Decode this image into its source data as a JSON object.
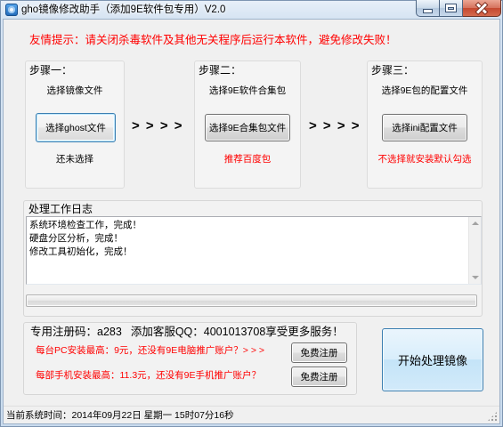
{
  "window": {
    "title": "gho镜像修改助手（添加9E软件包专用）V2.0"
  },
  "icons": {
    "app": "app-icon",
    "minimize": "minimize-icon",
    "maximize": "maximize-icon",
    "close": "close-icon",
    "scroll_up": "chevron-up-icon",
    "scroll_down": "chevron-down-icon",
    "resize_grip": "resize-grip-icon"
  },
  "colors": {
    "warning": "#ff0000",
    "normal_text": "#000000",
    "focus_border": "#3c7fb1",
    "close_button": "#c4472f"
  },
  "notice": "友情提示：请关闭杀毒软件及其他无关程序后运行本软件，避免修改失败！",
  "steps": [
    {
      "label": "步骤一：",
      "description": "选择镜像文件",
      "button": "选择ghost文件",
      "status": "还未选择",
      "status_color": "#000000"
    },
    {
      "label": "步骤二：",
      "description": "选择9E软件合集包",
      "button": "选择9E合集包文件",
      "status": "推荐百度包",
      "status_color": "#ff0000"
    },
    {
      "label": "步骤三：",
      "description": "选择9E包的配置文件",
      "button": "选择ini配置文件",
      "status": "不选择就安装默认勾选",
      "status_color": "#ff0000"
    }
  ],
  "arrows": [
    "> > > >",
    "> > > >"
  ],
  "log": {
    "title": "处理工作日志",
    "lines": [
      "系统环境检查工作，完成！",
      "硬盘分区分析，完成！",
      "修改工具初始化，完成！"
    ],
    "progress_percent": 0
  },
  "registration": {
    "code_label": "专用注册码：",
    "code": "a283",
    "service_text": "添加客服QQ：4001013708享受更多服务！",
    "offers": [
      {
        "text": "每台PC安装最高：9元，还没有9E电脑推广账户？> > >",
        "button": "免费注册"
      },
      {
        "text": "每部手机安装最高：11.3元，还没有9E手机推广账户？",
        "button": "免费注册"
      }
    ]
  },
  "start_button": "开始处理镜像",
  "status_bar": {
    "time_text": "当前系统时间：2014年09月22日 星期一 15时07分16秒"
  }
}
